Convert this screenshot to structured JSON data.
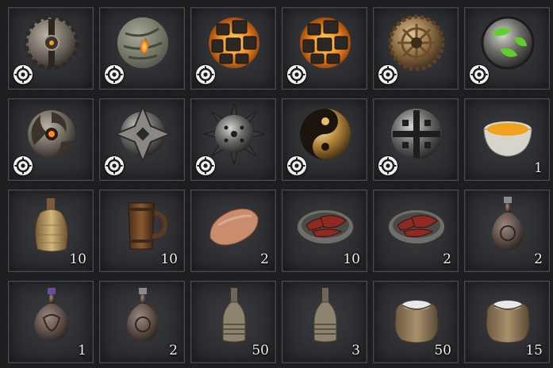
{
  "inventory": {
    "slots": [
      {
        "item": "ornate-gear-orb-icon",
        "quantity": "",
        "socket_badge": true
      },
      {
        "item": "cracked-green-orb-icon",
        "quantity": "",
        "socket_badge": true
      },
      {
        "item": "molten-rock-orb-icon",
        "quantity": "",
        "socket_badge": true
      },
      {
        "item": "molten-rock-orb-icon",
        "quantity": "",
        "socket_badge": true
      },
      {
        "item": "bronze-cogwheel-orb-icon",
        "quantity": "",
        "socket_badge": true
      },
      {
        "item": "green-rune-orb-icon",
        "quantity": "",
        "socket_badge": true
      },
      {
        "item": "swirl-amber-orb-icon",
        "quantity": "",
        "socket_badge": true
      },
      {
        "item": "steel-cross-orb-icon",
        "quantity": "",
        "socket_badge": true
      },
      {
        "item": "spiked-iron-orb-icon",
        "quantity": "",
        "socket_badge": true
      },
      {
        "item": "gold-yinyang-orb-icon",
        "quantity": "",
        "socket_badge": true
      },
      {
        "item": "iron-lattice-orb-icon",
        "quantity": "",
        "socket_badge": true
      },
      {
        "item": "soup-bowl-icon",
        "quantity": "1",
        "socket_badge": false
      },
      {
        "item": "wicker-jug-icon",
        "quantity": "10",
        "socket_badge": false
      },
      {
        "item": "wooden-tankard-icon",
        "quantity": "10",
        "socket_badge": false
      },
      {
        "item": "bread-loaf-icon",
        "quantity": "2",
        "socket_badge": false
      },
      {
        "item": "meat-platter-icon",
        "quantity": "10",
        "socket_badge": false
      },
      {
        "item": "meat-platter-icon",
        "quantity": "2",
        "socket_badge": false
      },
      {
        "item": "clay-flask-icon",
        "quantity": "2",
        "socket_badge": false
      },
      {
        "item": "purple-cork-flask-icon",
        "quantity": "1",
        "socket_badge": false
      },
      {
        "item": "clay-flask-icon",
        "quantity": "2",
        "socket_badge": false
      },
      {
        "item": "wrapped-bottle-icon",
        "quantity": "50",
        "socket_badge": false
      },
      {
        "item": "wrapped-bottle-icon",
        "quantity": "3",
        "socket_badge": false
      },
      {
        "item": "salt-sack-icon",
        "quantity": "50",
        "socket_badge": false
      },
      {
        "item": "salt-sack-icon",
        "quantity": "15",
        "socket_badge": false
      }
    ]
  },
  "colors": {
    "background": "#1c1d1f",
    "slot_border": "#4a4b4e",
    "quantity_text": "#ececec",
    "badge_fill": "#f2f2f2"
  }
}
